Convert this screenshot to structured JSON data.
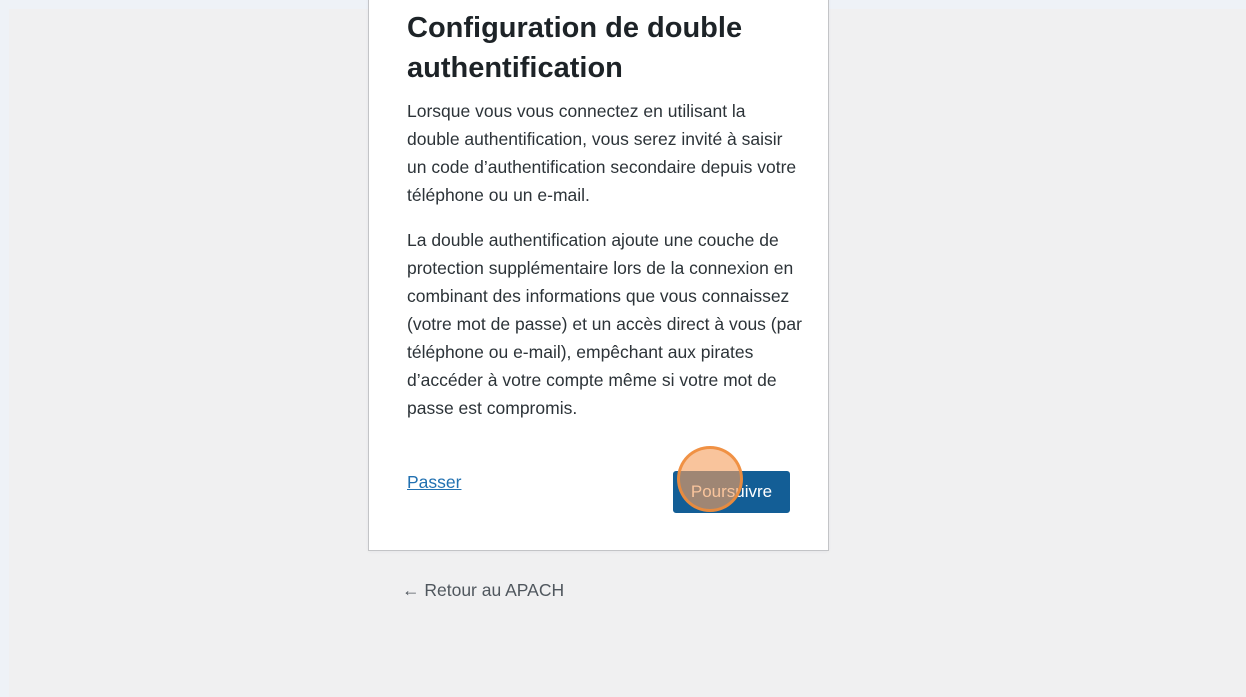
{
  "dialog": {
    "title": "Configuration de double authentification",
    "paragraph_1": "Lorsque vous vous connectez en utilisant la double authentification, vous serez invité à saisir un code d’authentification secondaire depuis votre téléphone ou un e-mail.",
    "paragraph_2": "La double authentification ajoute une couche de protection supplémentaire lors de la connexion en combinant des informations que vous connaissez (votre mot de passe) et un accès direct à vous (par téléphone ou e-mail), empêchant aux pirates d’accéder à votre compte même si votre mot de passe est compromis.",
    "skip_label": "Passer",
    "continue_label": "Poursuivre"
  },
  "footer": {
    "back_label": "← Retour au APACH"
  },
  "colors": {
    "primary": "#135e96",
    "link": "#2271b1",
    "click_marker": "#f5a05f"
  }
}
